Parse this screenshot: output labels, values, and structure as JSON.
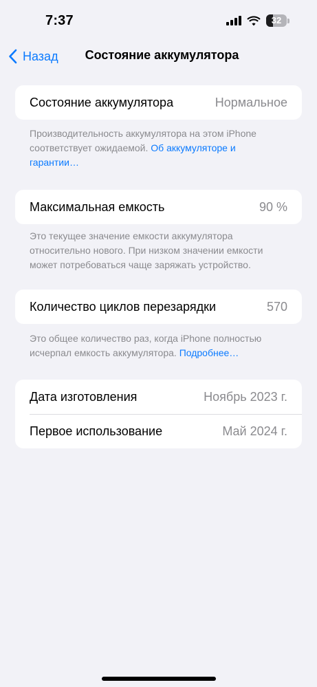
{
  "status_bar": {
    "time": "7:37",
    "battery_percent": "32",
    "battery_level": 0.32,
    "icons": [
      "cellular-signal-icon",
      "wifi-icon",
      "battery-icon"
    ]
  },
  "nav": {
    "back_label": "Назад",
    "title": "Состояние аккумулятора",
    "accent_color": "#0a7aff"
  },
  "battery_health": {
    "label": "Состояние аккумулятора",
    "value": "Нормальное",
    "footer_text": "Производительность аккумулятора на этом iPhone соответствует ожидаемой. ",
    "footer_link": "Об аккумуляторе и гарантии…"
  },
  "max_capacity": {
    "label": "Максимальная емкость",
    "value": "90 %",
    "footer_text": "Это текущее значение емкости аккумулятора относительно нового. При низком значении емкости может потребоваться чаще заряжать устройство."
  },
  "cycle_count": {
    "label": "Количество циклов перезарядки",
    "value": "570",
    "footer_text": "Это общее количество раз, когда iPhone полностью исчерпал емкость аккумулятора. ",
    "footer_link": "Подробнее…"
  },
  "dates": {
    "manufacture_label": "Дата изготовления",
    "manufacture_value": "Ноябрь 2023 г.",
    "first_use_label": "Первое использование",
    "first_use_value": "Май 2024 г."
  }
}
